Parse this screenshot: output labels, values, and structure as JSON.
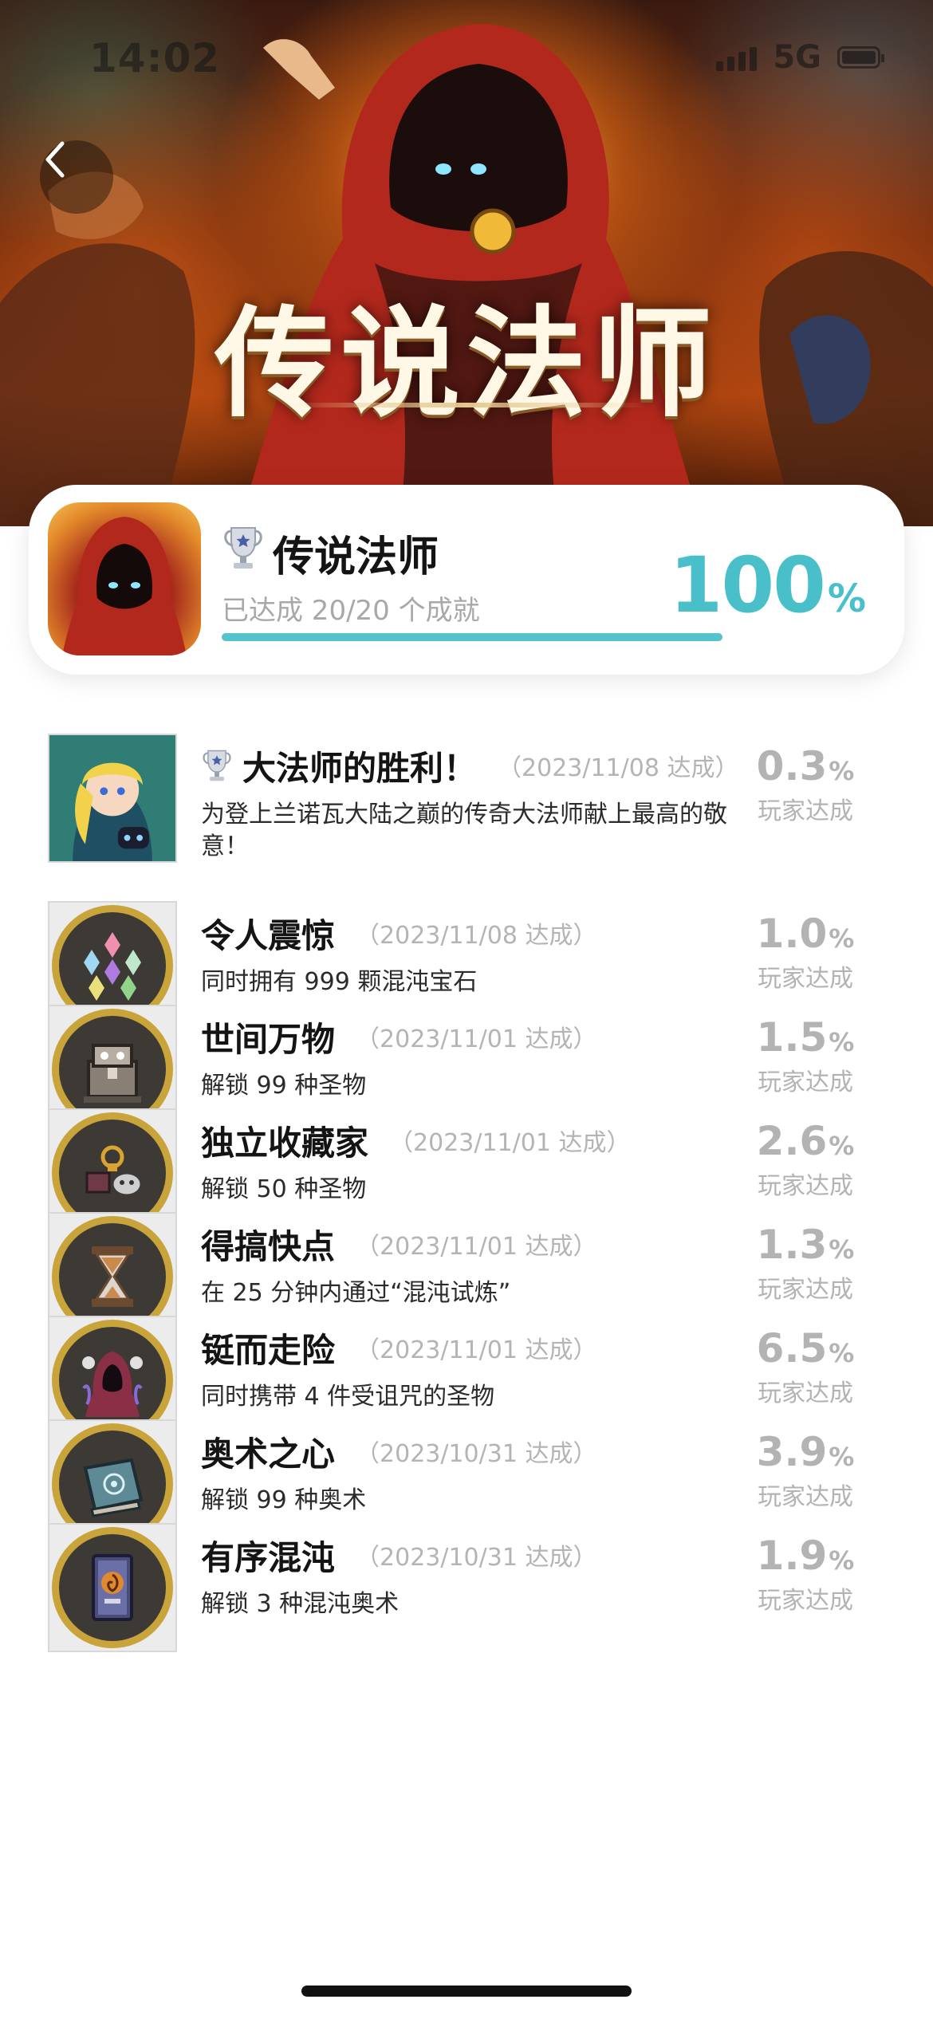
{
  "status_bar": {
    "time": "14:02",
    "network": "5G"
  },
  "hero": {
    "title": "传说法师"
  },
  "summary": {
    "game_name": "传说法师",
    "progress_text": "已达成 20/20 个成就",
    "progress": 1.0,
    "percent_value": "100",
    "percent_sign": "%"
  },
  "achievements": [
    {
      "title": "大法师的胜利！",
      "date": "（2023/11/08 达成）",
      "description": "为登上兰诺瓦大陆之巅的传奇大法师献上最高的敬意！",
      "rate": "0.3",
      "rate_sign": "%",
      "rate_label": "玩家达成",
      "icon": "mage-portrait-icon",
      "trophy": true
    },
    {
      "title": "令人震惊",
      "date": "（2023/11/08 达成）",
      "description": "同时拥有 999 颗混沌宝石",
      "rate": "1.0",
      "rate_sign": "%",
      "rate_label": "玩家达成",
      "icon": "chaos-gems-icon"
    },
    {
      "title": "世间万物",
      "date": "（2023/11/01 达成）",
      "description": "解锁 99 种圣物",
      "rate": "1.5",
      "rate_sign": "%",
      "rate_label": "玩家达成",
      "icon": "relic-chest-icon"
    },
    {
      "title": "独立收藏家",
      "date": "（2023/11/01 达成）",
      "description": "解锁 50 种圣物",
      "rate": "2.6",
      "rate_sign": "%",
      "rate_label": "玩家达成",
      "icon": "relic-collection-icon"
    },
    {
      "title": "得搞快点",
      "date": "（2023/11/01 达成）",
      "description": "在 25 分钟内通过“混沌试炼”",
      "rate": "1.3",
      "rate_sign": "%",
      "rate_label": "玩家达成",
      "icon": "hourglass-icon"
    },
    {
      "title": "铤而走险",
      "date": "（2023/11/01 达成）",
      "description": "同时携带 4 件受诅咒的圣物",
      "rate": "6.5",
      "rate_sign": "%",
      "rate_label": "玩家达成",
      "icon": "cursed-wizard-icon"
    },
    {
      "title": "奥术之心",
      "date": "（2023/10/31 达成）",
      "description": "解锁 99 种奥术",
      "rate": "3.9",
      "rate_sign": "%",
      "rate_label": "玩家达成",
      "icon": "arcana-book-icon"
    },
    {
      "title": "有序混沌",
      "date": "（2023/10/31 达成）",
      "description": "解锁 3 种混沌奥术",
      "rate": "1.9",
      "rate_sign": "%",
      "rate_label": "玩家达成",
      "icon": "chaos-arcana-card-icon"
    }
  ],
  "colors": {
    "accent": "#49bfca",
    "progress": "#55c3cc",
    "muted": "#b3b3b3",
    "badge_gold": "#c9a43a"
  }
}
